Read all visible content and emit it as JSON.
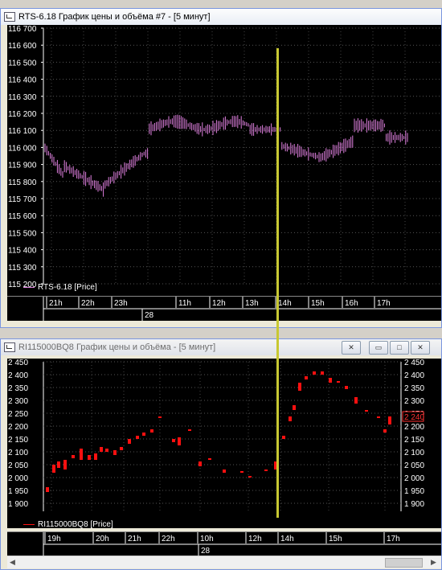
{
  "window1": {
    "title": "RTS-6.18 График цены и объёма #7 - [5 минут]",
    "y_ticks": [
      "116 700",
      "116 600",
      "116 500",
      "116 400",
      "116 300",
      "116 200",
      "116 100",
      "116 000",
      "115 900",
      "115 800",
      "115 700",
      "115 600",
      "115 500",
      "115 400",
      "115 300",
      "115 200"
    ],
    "legend": "RTS-6.18 [Price]",
    "time_ticks": [
      "21h",
      "22h",
      "23h",
      "11h",
      "12h",
      "13h",
      "14h",
      "15h",
      "16h",
      "17h"
    ],
    "day_label": "28",
    "series_color": "#e080e0"
  },
  "window2": {
    "title": "RI115000BQ8 График цены и объёма - [5 минут]",
    "y_ticks": [
      "2 450",
      "2 400",
      "2 350",
      "2 300",
      "2 250",
      "2 200",
      "2 150",
      "2 100",
      "2 050",
      "2 000",
      "1 950",
      "1 900"
    ],
    "legend": "RI115000BQ8 [Price]",
    "time_ticks": [
      "19h",
      "20h",
      "21h",
      "22h",
      "10h",
      "12h",
      "14h",
      "15h",
      "17h"
    ],
    "day_label": "28",
    "last_price": "2 240",
    "series_color": "#ff1010",
    "controls": [
      "restore-icon",
      "minimize-icon",
      "maximize-icon",
      "close-icon"
    ]
  },
  "cursor_color": "#c8c832"
}
